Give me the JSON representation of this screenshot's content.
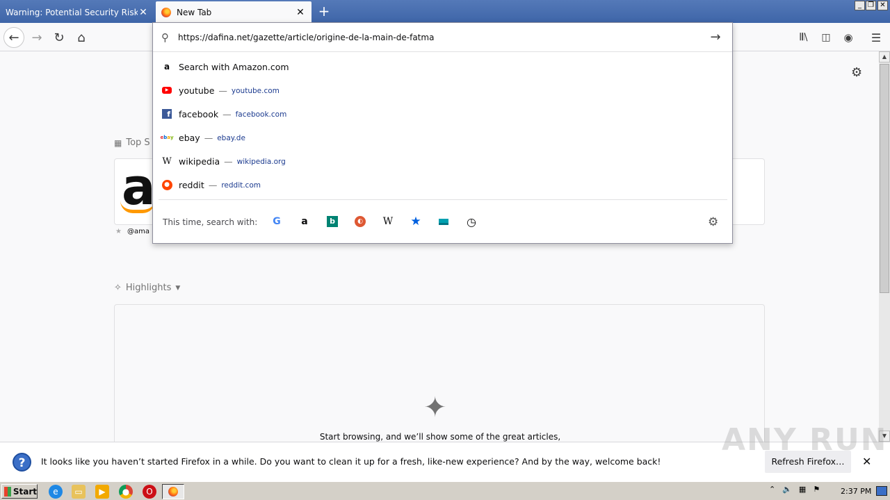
{
  "tabs": [
    {
      "label": "Warning: Potential Security Risk Ahead",
      "active": false
    },
    {
      "label": "New Tab",
      "active": true
    }
  ],
  "window_controls": {
    "minimize": "_",
    "restore": "❐",
    "close": "✕"
  },
  "urlbar": {
    "value": "https://dafina.net/gazette/article/origine-de-la-main-de-fatma"
  },
  "suggestions": [
    {
      "title": "Search with Amazon.com",
      "url": "",
      "icon": "amazon-icon",
      "icon_color": "#111111"
    },
    {
      "title": "youtube",
      "url": "youtube.com",
      "icon": "youtube-icon",
      "icon_color": "#ff0000"
    },
    {
      "title": "facebook",
      "url": "facebook.com",
      "icon": "facebook-icon",
      "icon_color": "#3b5998"
    },
    {
      "title": "ebay",
      "url": "ebay.de",
      "icon": "ebay-icon",
      "icon_color": "#e53238"
    },
    {
      "title": "wikipedia",
      "url": "wikipedia.org",
      "icon": "wikipedia-icon",
      "icon_color": "#000000"
    },
    {
      "title": "reddit",
      "url": "reddit.com",
      "icon": "reddit-icon",
      "icon_color": "#ff4500"
    }
  ],
  "suggestion_dash": "—",
  "one_off": {
    "label": "This time, search with:",
    "engines": [
      "google-icon",
      "amazon-icon",
      "bing-icon",
      "duckduckgo-icon",
      "wikipedia-icon",
      "bookmarks-icon",
      "tabs-icon",
      "history-icon"
    ]
  },
  "newtab": {
    "topsites_title": "Top S",
    "topsite_label": "@ama",
    "highlights_title": "Highlights",
    "highlights_message": "Start browsing, and we’ll show some of the great articles,"
  },
  "notification": {
    "message": "It looks like you haven’t started Firefox in a while. Do you want to clean it up for a fresh, like-new experience? And by the way, welcome back!",
    "button": "Refresh Firefox…"
  },
  "watermark": "ANY RUN",
  "taskbar": {
    "start_label": "Start",
    "clock": "2:37 PM"
  }
}
